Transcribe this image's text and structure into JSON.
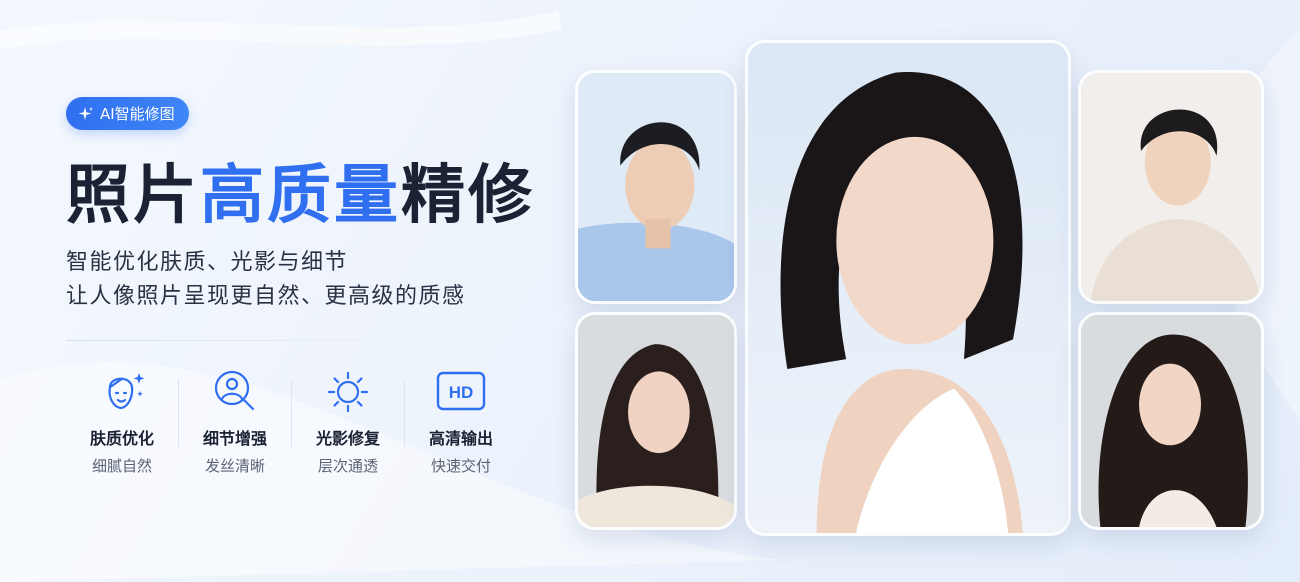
{
  "badge": {
    "icon": "sparkle-icon",
    "label": "AI智能修图"
  },
  "headline": {
    "part1": "照片",
    "highlight": "高质量",
    "part2": "精修"
  },
  "description": [
    "智能优化肤质、光影与细节",
    "让人像照片呈现更自然、更高级的质感"
  ],
  "features": [
    {
      "icon": "face-sparkle-icon",
      "title": "肤质优化",
      "subtitle": "细腻自然"
    },
    {
      "icon": "magnify-person-icon",
      "title": "细节增强",
      "subtitle": "发丝清晰"
    },
    {
      "icon": "sun-icon",
      "title": "光影修复",
      "subtitle": "层次通透"
    },
    {
      "icon": "hd-icon",
      "title": "高清输出",
      "subtitle": "快速交付",
      "icon_text": "HD"
    }
  ],
  "colors": {
    "accent": "#2f6ff0",
    "text": "#1a2233",
    "muted": "#5b6474"
  }
}
